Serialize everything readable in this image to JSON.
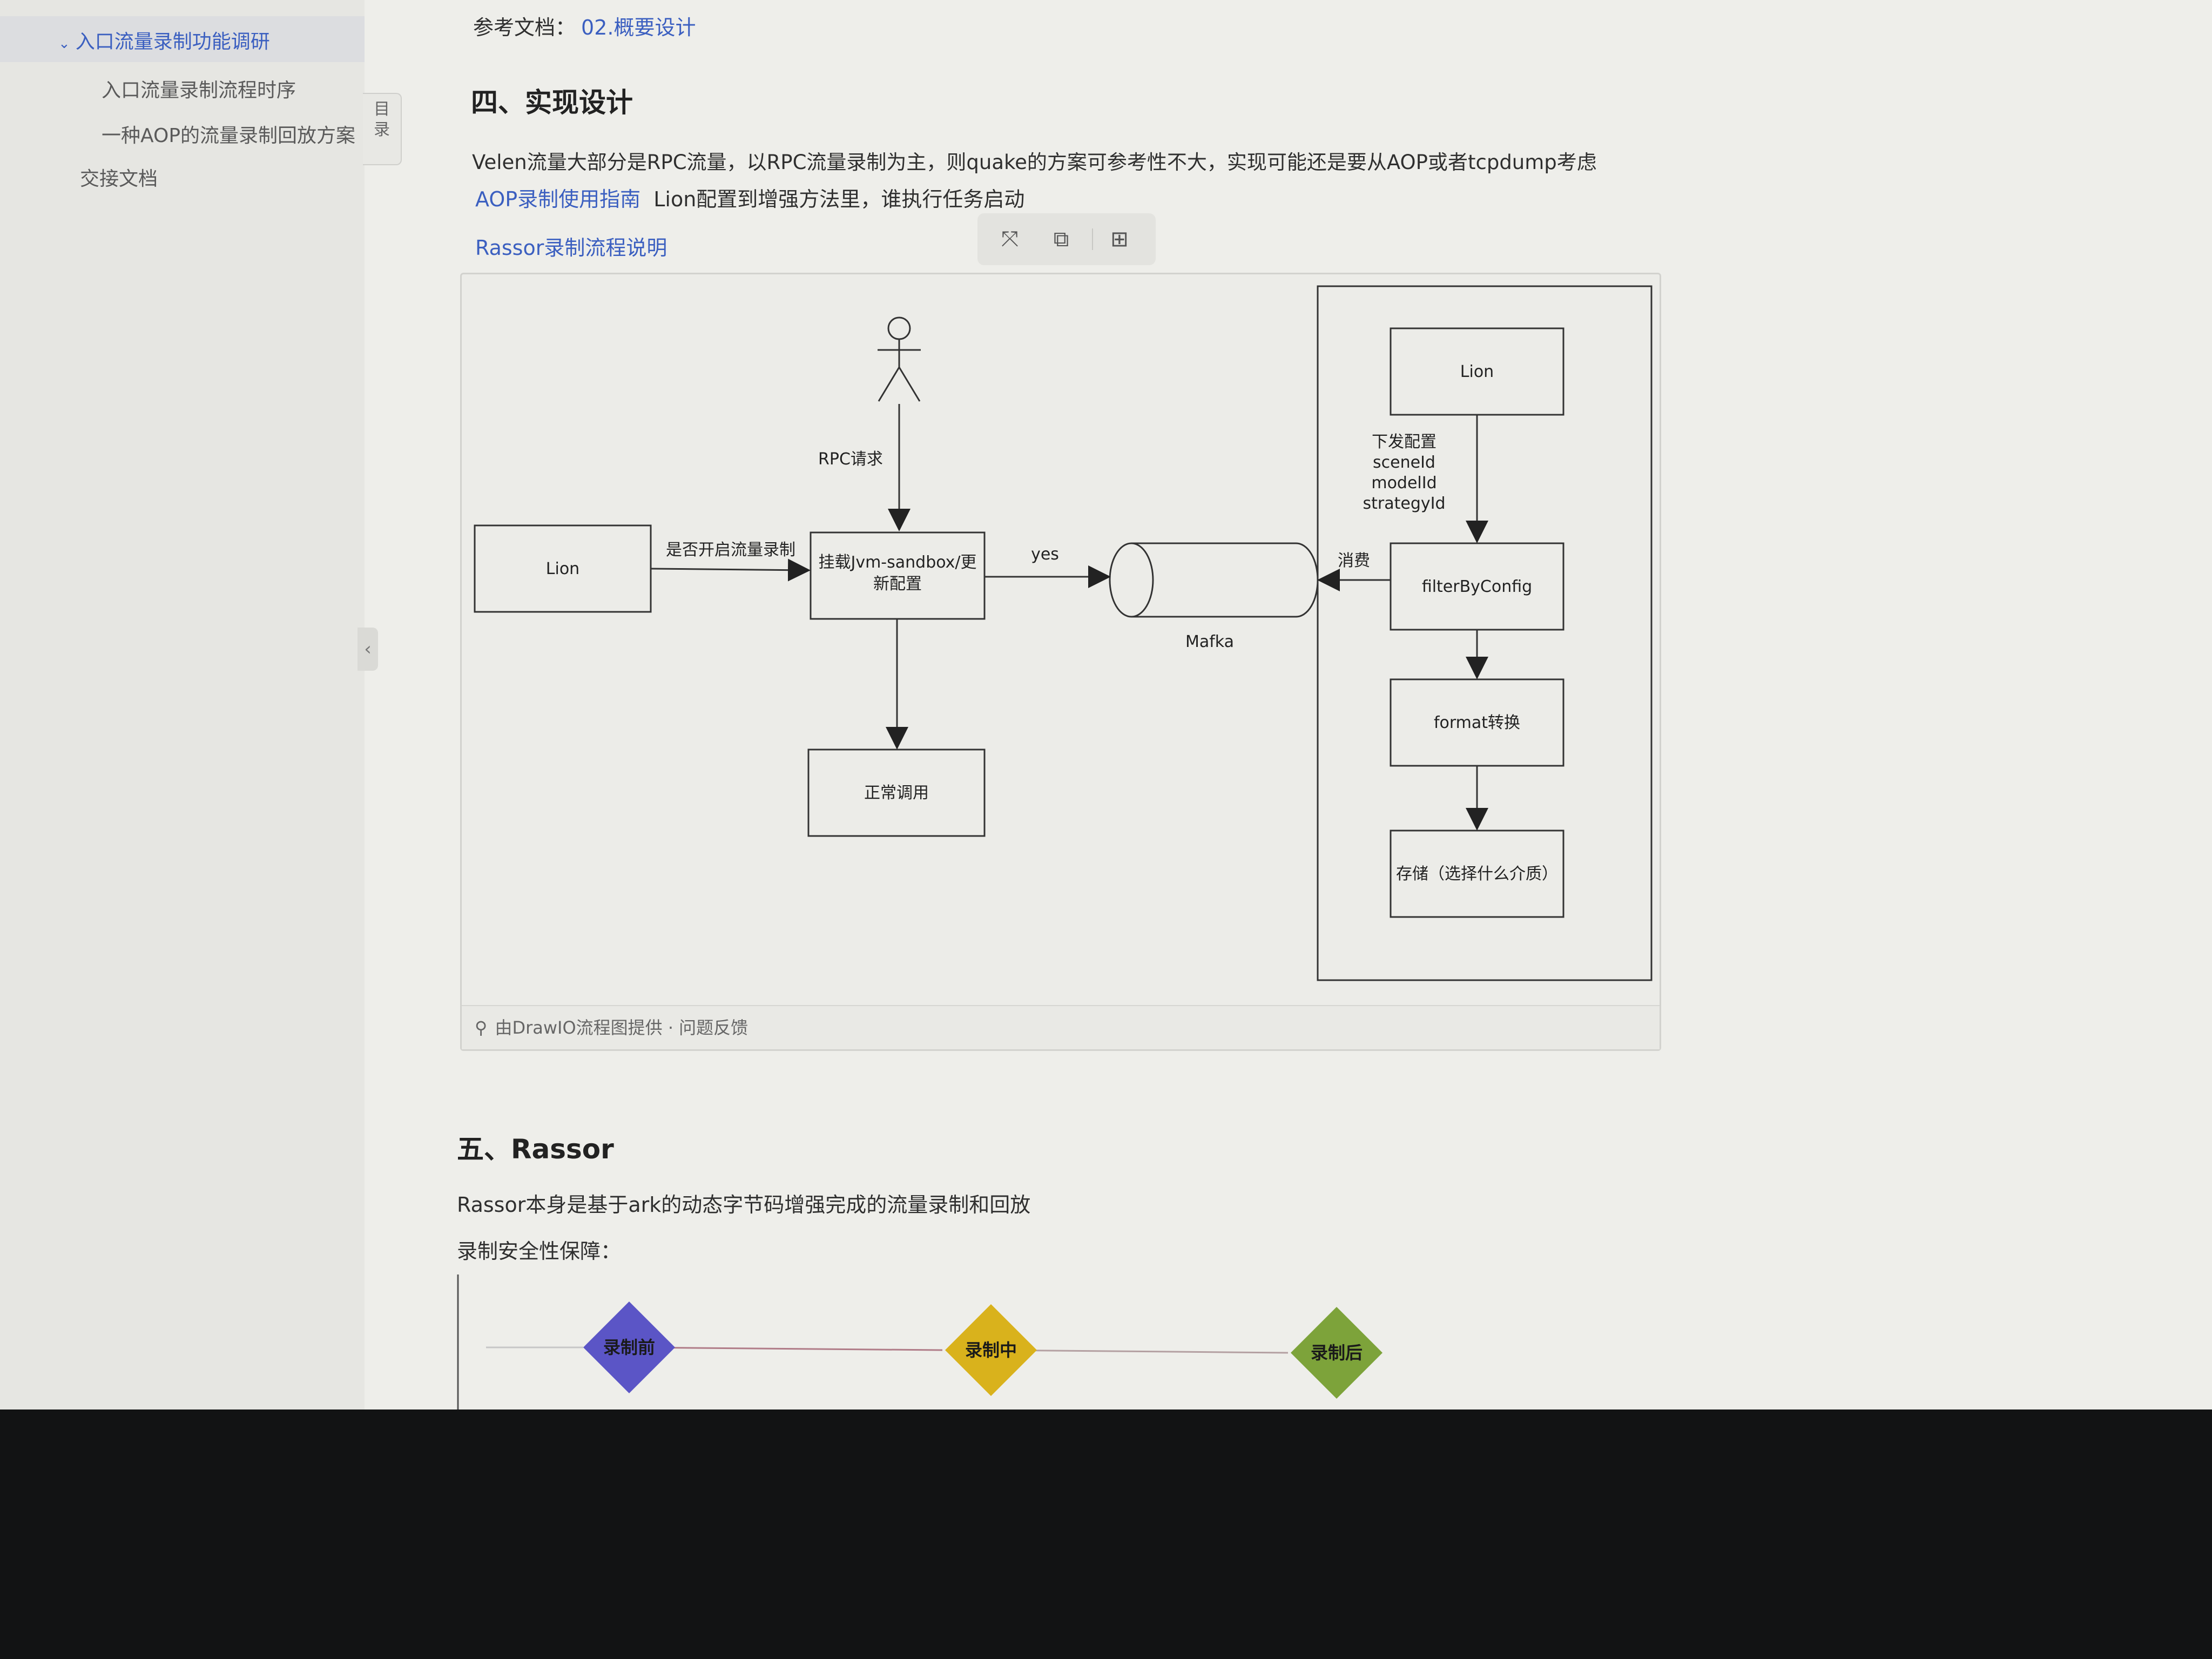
{
  "sidebar": {
    "active_item": "入口流量录制功能调研",
    "items": [
      "入口流量录制流程时序",
      "一种AOP的流量录制回放方案"
    ],
    "bottom_item": "交接文档",
    "toc_tab": "目录",
    "collapse": "‹"
  },
  "doc": {
    "ref_label": "参考文档：",
    "ref_link": "02.概要设计",
    "section4_title": "四、实现设计",
    "section4_p1": "Velen流量大部分是RPC流量，以RPC流量录制为主，则quake的方案可参考性不大，实现可能还是要从AOP或者tcpdump考虑",
    "aop_link": "AOP录制使用指南",
    "aop_text": "Lion配置到增强方法里，谁执行任务启动",
    "rassor_link": "Rassor录制流程说明",
    "section5_title": "五、Rassor",
    "section5_p1": "Rassor本身是基于ark的动态字节码增强完成的流量录制和回放",
    "section5_p2": "录制安全性保障："
  },
  "diagram": {
    "actor_label": "RPC请求",
    "lion_left": "Lion",
    "edge_switch": "是否开启流量录制",
    "mount_box_line1": "挂载Jvm-sandbox/更",
    "mount_box_line2": "新配置",
    "edge_yes": "yes",
    "mafka": "Mafka",
    "normal_call": "正常调用",
    "lion_right": "Lion",
    "edge_config_lines": [
      "下发配置",
      "sceneId",
      "modelId",
      "strategyId"
    ],
    "edge_consume": "消费",
    "filter": "filterByConfig",
    "format": "format转换",
    "storage": "存储（选择什么介质）",
    "footer": "由DrawIO流程图提供 · 问题反馈"
  },
  "timeline": {
    "nodes": [
      {
        "label": "录制前",
        "color": "#5b55c6"
      },
      {
        "label": "录制中",
        "color": "#d9b21c"
      },
      {
        "label": "录制后",
        "color": "#7da33a"
      }
    ]
  }
}
